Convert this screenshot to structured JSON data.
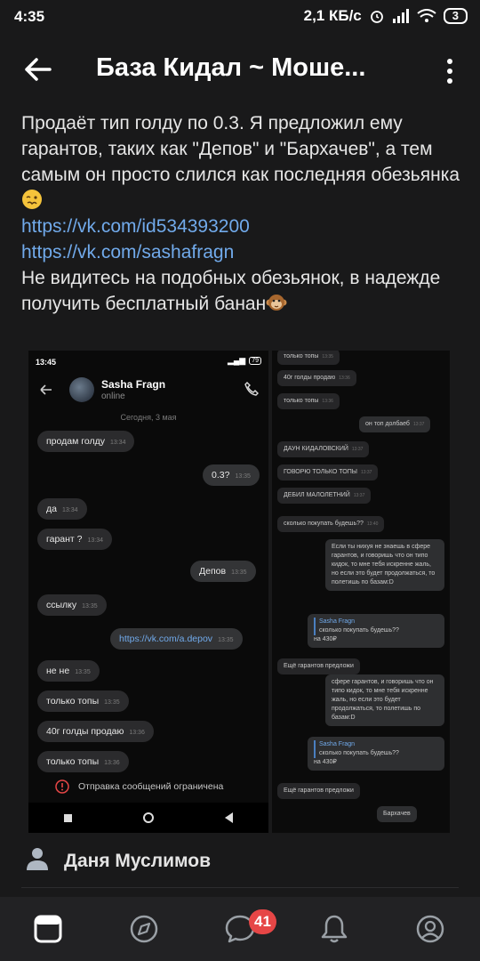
{
  "status_bar": {
    "time": "4:35",
    "speed": "2,1 КБ/с",
    "battery": "3"
  },
  "header": {
    "title": "База Кидал ~ Моше..."
  },
  "post": {
    "text_1": "Продаёт тип голду по 0.3. Я предложил ему гарантов, таких как \"Депов\" и \"Бархачев\", а тем самым он просто слился как последняя обезьянка",
    "link_1": "https://vk.com/id534393200",
    "link_2": "https://vk.com/sashafragn",
    "text_2": "Не видитесь на подобных обезьянок, в надежде получить бесплатный банан"
  },
  "screenshot_left": {
    "time": "13:45",
    "battery": "79",
    "contact_name": "Sasha Fragn",
    "contact_status": "online",
    "date": "Сегодня, 3 мая",
    "messages": [
      {
        "text": "продам голду",
        "time": "13:34"
      },
      {
        "text": "0.3?",
        "time": "13:35"
      },
      {
        "text": "да",
        "time": "13:34"
      },
      {
        "text": "гарант ?",
        "time": "13:34"
      },
      {
        "text": "Депов",
        "time": "13:35"
      },
      {
        "text": "ссылку",
        "time": "13:35"
      },
      {
        "text": "https://vk.com/a.depov",
        "time": "13:35"
      },
      {
        "text": "не не",
        "time": "13:35"
      },
      {
        "text": "только топы",
        "time": "13:35"
      },
      {
        "text": "40г голды продаю",
        "time": "13:36"
      },
      {
        "text": "только топы",
        "time": "13:36"
      }
    ],
    "restriction": "Отправка сообщений ограничена"
  },
  "screenshot_right": {
    "messages": [
      {
        "text": "только топы",
        "time": "13:35"
      },
      {
        "text": "40г голды продаю",
        "time": "13:36"
      },
      {
        "text": "только топы",
        "time": "13:36"
      },
      {
        "text": "он топ долбаеб",
        "time": "13:37"
      },
      {
        "text": "ДАУН КИДАЛОВСКИЙ",
        "time": "13:37"
      },
      {
        "text": "ГОВОРЮ ТОЛЬКО ТОПЫ",
        "time": "13:37"
      },
      {
        "text": "ДЕБИЛ МАЛОЛЕТНИЙ",
        "time": "13:37"
      },
      {
        "text": "сколько покупать будешь??",
        "time": "13:40"
      },
      {
        "text": "Если ты нихуя не знаешь в сфере гарантов, и говоришь что он типо кидок, то мне тебя искренне жаль, но если это будет продолжаться, то полетишь по базам:D",
        "time": ""
      },
      {
        "quote_name": "Sasha Fragn",
        "quote_text": "сколько покупать будешь??",
        "text": "на 430₽",
        "time": ""
      },
      {
        "text": "Ещё гарантов предложи",
        "time": ""
      },
      {
        "text": "сфере гарантов, и говоришь что он типо кидок, то мне тебя искренне жаль, но если это будет продолжаться, то полетишь по базам:D",
        "time": ""
      },
      {
        "quote_name": "Sasha Fragn",
        "quote_text": "сколько покупать будешь??",
        "text": "на 430₽",
        "time": ""
      },
      {
        "text": "Ещё гарантов предложи",
        "time": ""
      },
      {
        "text": "Бархачев",
        "time": ""
      }
    ]
  },
  "comment_author": {
    "name": "Даня Муслимов"
  },
  "bottom_nav": {
    "badge_count": "41"
  },
  "colors": {
    "background": "#19191a",
    "link": "#71aaeb",
    "badge": "#e64646"
  }
}
